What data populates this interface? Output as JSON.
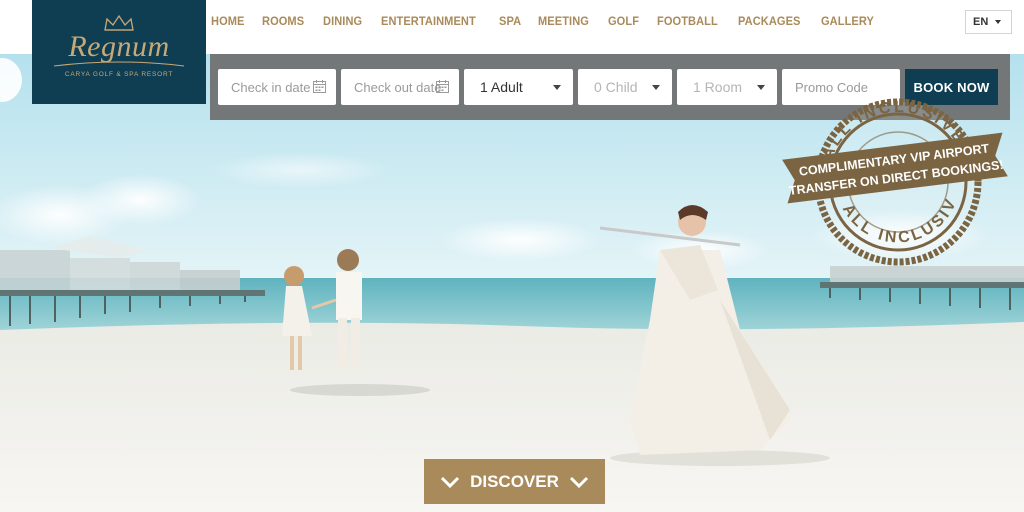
{
  "logo": {
    "brand": "Regnum",
    "tagline": "CARYA GOLF & SPA RESORT"
  },
  "nav": {
    "items": [
      "HOME",
      "ROOMS",
      "DINING",
      "ENTERTAINMENT",
      "SPA",
      "MEETING",
      "GOLF",
      "FOOTBALL",
      "PACKAGES",
      "GALLERY"
    ]
  },
  "language": {
    "selected": "EN"
  },
  "booking": {
    "check_in_placeholder": "Check in date",
    "check_out_placeholder": "Check out date",
    "adults": "1 Adult",
    "children": "0 Child",
    "rooms": "1 Room",
    "promo_placeholder": "Promo Code",
    "book_label": "BOOK NOW"
  },
  "badge": {
    "line1": "COMPLIMENTARY VIP AIRPORT",
    "line2": "TRANSFER ON DIRECT BOOKINGS!",
    "ring_text": "ALL INCLUSIVE · ALL INCLUSIVE"
  },
  "hero": {
    "discover_label": "DISCOVER"
  },
  "colors": {
    "navy": "#0f3d52",
    "gold": "#a98a5a",
    "badge_brown": "#7a6442"
  },
  "icons": {
    "calendar": "calendar-icon",
    "caret": "caret-down-icon",
    "discover": "chevron-down-icon",
    "crown": "crown-icon"
  }
}
